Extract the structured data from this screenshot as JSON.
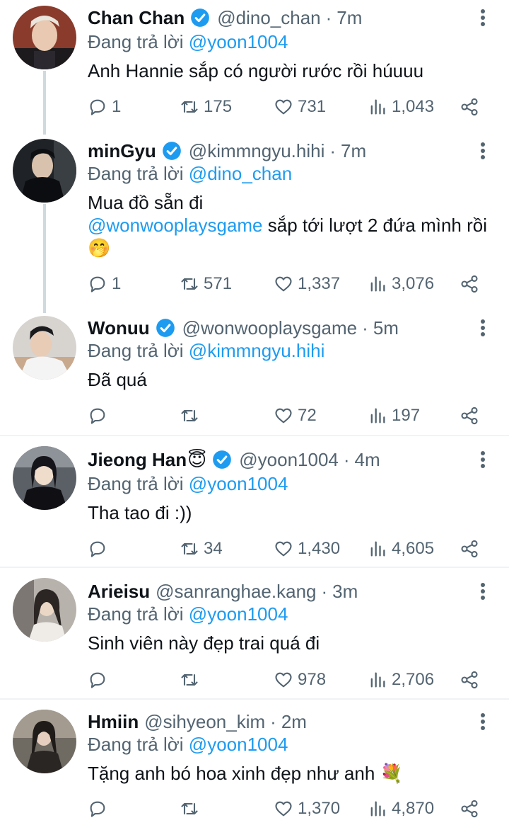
{
  "tweets": [
    {
      "name": "Chan Chan",
      "name_emoji": "",
      "verified": true,
      "handle": "@dino_chan",
      "time": "7m",
      "reply_prefix": "Đang trả lời",
      "reply_to": "@yoon1004",
      "text_before": "Anh Hannie sắp có người rước rồi húuuu",
      "text_mention": "",
      "text_after": "",
      "stats": {
        "replies": "1",
        "retweets": "175",
        "likes": "731",
        "views": "1,043"
      }
    },
    {
      "name": "minGyu",
      "name_emoji": "",
      "verified": true,
      "handle": "@kimmngyu.hihi",
      "time": "7m",
      "reply_prefix": "Đang trả lời",
      "reply_to": "@dino_chan",
      "text_before": "Mua đồ sẵn đi",
      "text_mention": "@wonwooplaysgame",
      "text_after": " sắp tới lượt 2 đứa mình rồi 🤭",
      "stats": {
        "replies": "1",
        "retweets": "571",
        "likes": "1,337",
        "views": "3,076"
      }
    },
    {
      "name": "Wonuu",
      "name_emoji": "",
      "verified": true,
      "handle": "@wonwooplaysgame",
      "time": "5m",
      "reply_prefix": "Đang trả lời",
      "reply_to": "@kimmngyu.hihi",
      "text_before": "Đã quá",
      "text_mention": "",
      "text_after": "",
      "stats": {
        "replies": "",
        "retweets": "",
        "likes": "72",
        "views": "197"
      }
    },
    {
      "name": "Jieong Han",
      "name_emoji": "😇",
      "verified": true,
      "handle": "@yoon1004",
      "time": "4m",
      "reply_prefix": "Đang trả lời",
      "reply_to": "@yoon1004",
      "text_before": "Tha tao đi :))",
      "text_mention": "",
      "text_after": "",
      "stats": {
        "replies": "",
        "retweets": "34",
        "likes": "1,430",
        "views": "4,605"
      }
    },
    {
      "name": "Arieisu",
      "name_emoji": "",
      "verified": false,
      "handle": "@sanranghae.kang",
      "time": "3m",
      "reply_prefix": "Đang trả lời",
      "reply_to": "@yoon1004",
      "text_before": "Sinh viên này đẹp trai quá đi",
      "text_mention": "",
      "text_after": "",
      "stats": {
        "replies": "",
        "retweets": "",
        "likes": "978",
        "views": "2,706"
      }
    },
    {
      "name": "Hmiin",
      "name_emoji": "",
      "verified": false,
      "handle": "@sihyeon_kim",
      "time": "2m",
      "reply_prefix": "Đang trả lời",
      "reply_to": "@yoon1004",
      "text_before": "Tặng anh bó hoa xinh đẹp như anh 💐",
      "text_mention": "",
      "text_after": "",
      "stats": {
        "replies": "",
        "retweets": "",
        "likes": "1,370",
        "views": "4,870"
      }
    }
  ],
  "icons": {
    "reply": "reply-icon",
    "retweet": "retweet-icon",
    "like": "heart-icon",
    "views": "views-icon",
    "share": "share-icon",
    "more": "more-icon",
    "verified": "verified-badge-icon"
  },
  "colors": {
    "accent": "#1d9bf0",
    "muted": "#536471",
    "text": "#0f1419",
    "divider": "#eff3f4",
    "thread_line": "#cfd9de"
  }
}
